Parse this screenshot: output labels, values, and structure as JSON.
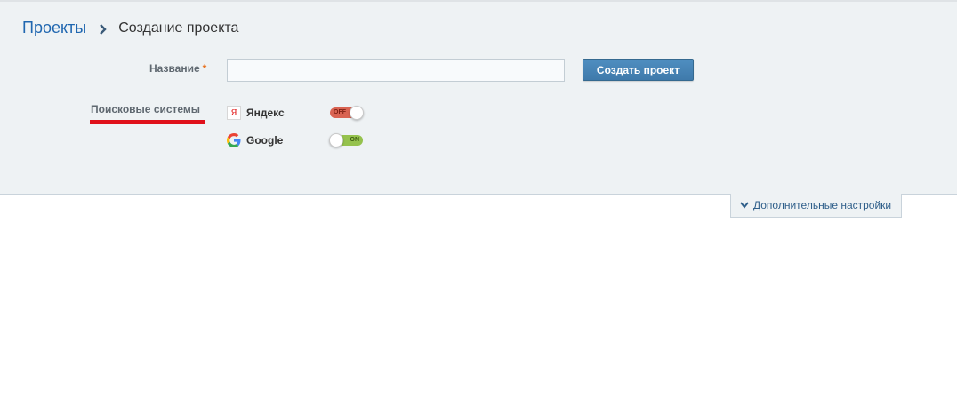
{
  "breadcrumb": {
    "parent": "Проекты",
    "current": "Создание проекта"
  },
  "form": {
    "name_label": "Название",
    "required_mark": "*",
    "name_value": "",
    "name_placeholder": "",
    "create_button": "Создать проект"
  },
  "search_engines": {
    "label": "Поисковые системы",
    "items": [
      {
        "name": "Яндекс",
        "icon": "yandex-icon",
        "icon_glyph": "Я",
        "state": "OFF",
        "enabled": false
      },
      {
        "name": "Google",
        "icon": "google-icon",
        "state": "ON",
        "enabled": true
      }
    ]
  },
  "extra_settings": {
    "label": "Дополнительные настройки",
    "icon": "chevron-down-icon"
  },
  "colors": {
    "panel_bg": "#eef2f4",
    "link": "#2067b0",
    "button": "#3f7aab",
    "required": "#e76f1a",
    "toggle_off": "#d96352",
    "toggle_on": "#95c24d",
    "highlight_underline": "#e0111b"
  }
}
